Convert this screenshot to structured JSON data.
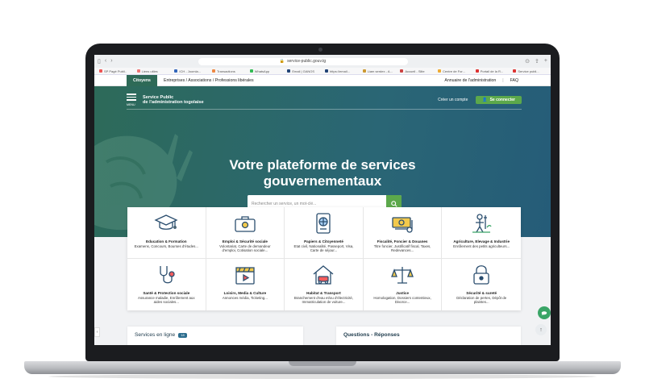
{
  "browser": {
    "url": "service-public.gouv.tg",
    "bookmarks": [
      "SP Pagé Publi..",
      "Liens utiles",
      "ICH - Joomla...",
      "Transactions",
      "WhatsApp",
      "Email | GANOS",
      "https://email...",
      "Liam serdex - A...",
      "Accueil - Slite",
      "Centre de For...",
      "Portail de la R...",
      "Service publi..."
    ]
  },
  "topnav": {
    "citoyens": "Citoyens",
    "entreprises": "Entreprises / Associations / Professions libérales",
    "annuaire": "Annuaire de l'administration",
    "separator": "|",
    "faq": "FAQ"
  },
  "header": {
    "menu_label": "MENU",
    "brand_line1": "Service Public",
    "brand_line2": "de l'administration togolaise",
    "create_account": "Créer un compte",
    "login": "Se connecter"
  },
  "hero": {
    "title_line1": "Votre plateforme de services",
    "title_line2": "gouvernementaux",
    "search_placeholder": "Rechercher un service, un mot-clé..."
  },
  "categories": [
    {
      "icon": "graduation-cap-icon",
      "title": "Education & Formation",
      "desc": "Examens, Concours, Bourses d'études..."
    },
    {
      "icon": "briefcase-icon",
      "title": "Emploi & Sécurité sociale",
      "desc": "Volontariat, Carte de demandeur d'emploi, Cotisation sociale..."
    },
    {
      "icon": "passport-icon",
      "title": "Papiers & Citoyenneté",
      "desc": "Etat civil, Nationalité, Passeport, Visa, Carte de séjour..."
    },
    {
      "icon": "money-icon",
      "title": "Fiscalité, Foncier & Douanes",
      "desc": "Titre foncier, Justificatif fiscal, Taxes, Redevances..."
    },
    {
      "icon": "farmer-icon",
      "title": "Agriculture, Elevage & Industrie",
      "desc": "Enrôlement des petits agriculteurs..."
    },
    {
      "icon": "stethoscope-icon",
      "title": "Santé & Protection sociale",
      "desc": "Assurance maladie, Enrôlement aux aides sociales..."
    },
    {
      "icon": "clapperboard-icon",
      "title": "Loisirs, Media & Culture",
      "desc": "Annonces média, Ticketing..."
    },
    {
      "icon": "house-icon",
      "title": "Habitat & Transport",
      "desc": "Branchement d'eau et/ou d'électricité, Immatriculation de voiture..."
    },
    {
      "icon": "scales-icon",
      "title": "Justice",
      "desc": "Homologation, Dossiers contentieux, Divorce..."
    },
    {
      "icon": "padlock-icon",
      "title": "Sécurité & sureté",
      "desc": "Déclaration de pertes, Dépôt de plaintes..."
    }
  ],
  "panels": {
    "services_title": "Services en ligne",
    "services_badge": "18",
    "questions_title": "Questions - Réponses"
  },
  "colors": {
    "brand_green": "#2e6a57",
    "button_green": "#5ca84b",
    "hero_blue": "#255c78"
  }
}
